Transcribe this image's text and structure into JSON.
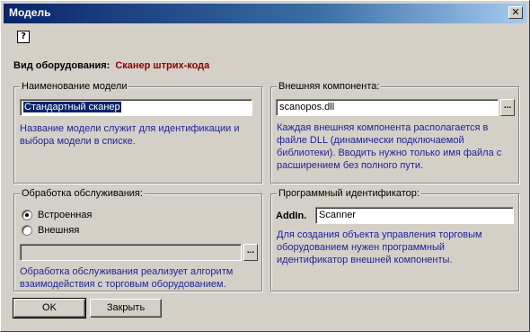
{
  "window": {
    "title": "Модель",
    "close_glyph": "✕",
    "help_glyph": "?"
  },
  "equipment": {
    "label": "Вид оборудования:",
    "value": "Сканер штрих-кода",
    "value_color": "#8b0000"
  },
  "model_group": {
    "legend": "Наименование модели",
    "value": "Стандартный сканер",
    "hint": "Название модели служит для идентификации и выбора модели в списке."
  },
  "external_group": {
    "legend": "Внешняя компонента:",
    "value": "scanopos.dll",
    "browse_label": "...",
    "hint": "Каждая внешняя компонента располагается в файле DLL (динамически подключаемой библиотеки). Вводить нужно только имя файла с расширением без полного пути."
  },
  "processing_group": {
    "legend": "Обработка обслуживания:",
    "options": [
      {
        "label": "Встроенная",
        "checked": true
      },
      {
        "label": "Внешняя",
        "checked": false
      }
    ],
    "path_value": "",
    "browse_label": "...",
    "hint": "Обработка обслуживания реализует алгоритм взаимодействия с торговым оборудованием."
  },
  "progid_group": {
    "legend": "Программный идентификатор:",
    "prefix": "AddIn.",
    "value": "Scanner",
    "hint": "Для создания объекта управления торговым оборудованием нужен программный идентификатор внешней компоненты."
  },
  "buttons": {
    "ok": "OK",
    "close": "Закрыть"
  },
  "colors": {
    "titlebar_start": "#0a246a",
    "titlebar_end": "#a6caf0",
    "hint_text": "#1f1f9a",
    "face": "#d4d0c8"
  }
}
